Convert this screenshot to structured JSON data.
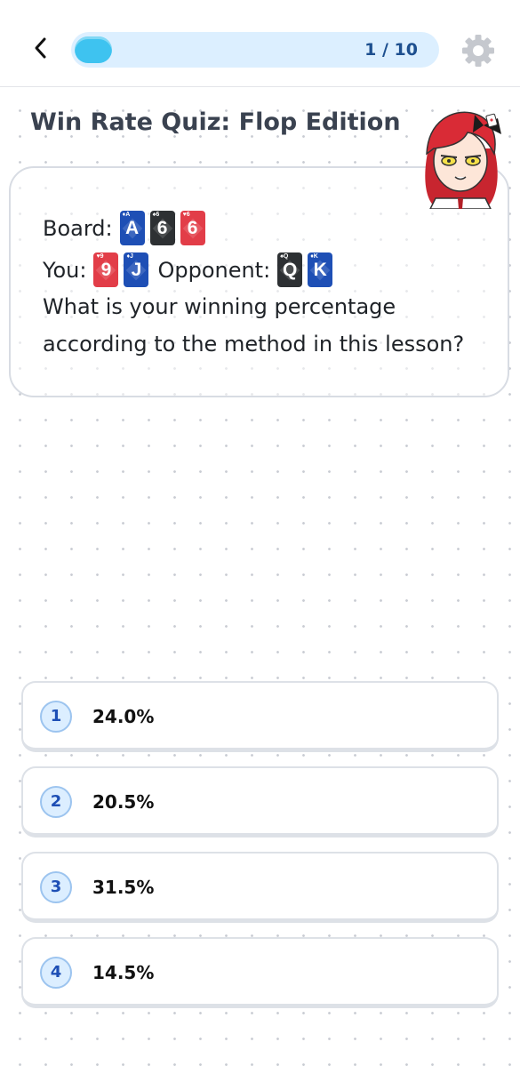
{
  "header": {
    "progress_text": "1 / 10",
    "progress_fraction": 0.1
  },
  "title": "Win Rate Quiz: Flop Edition",
  "question": {
    "board_label": "Board:",
    "board_cards": [
      {
        "rank": "A",
        "suit": "diamonds",
        "color": "blue"
      },
      {
        "rank": "6",
        "suit": "spades",
        "color": "black"
      },
      {
        "rank": "6",
        "suit": "hearts",
        "color": "red"
      }
    ],
    "you_label": "You:",
    "you_cards": [
      {
        "rank": "9",
        "suit": "hearts",
        "color": "red"
      },
      {
        "rank": "J",
        "suit": "diamonds",
        "color": "blue"
      }
    ],
    "opponent_label": "Opponent:",
    "opponent_cards": [
      {
        "rank": "Q",
        "suit": "spades",
        "color": "black"
      },
      {
        "rank": "K",
        "suit": "diamonds",
        "color": "blue"
      }
    ],
    "text_line1": "What is your winning percentage",
    "text_line2": "according to the method in this lesson?"
  },
  "options": [
    {
      "num": "1",
      "text": "24.0%"
    },
    {
      "num": "2",
      "text": "20.5%"
    },
    {
      "num": "3",
      "text": "31.5%"
    },
    {
      "num": "4",
      "text": "14.5%"
    }
  ],
  "icons": {
    "back": "chevron-left-icon",
    "settings": "gear-icon"
  },
  "colors": {
    "accent": "#3ec3f0",
    "progress_track": "#dcefff",
    "card_blue": "#1e4fb5",
    "card_black": "#2d3033",
    "card_red": "#e23d48"
  }
}
